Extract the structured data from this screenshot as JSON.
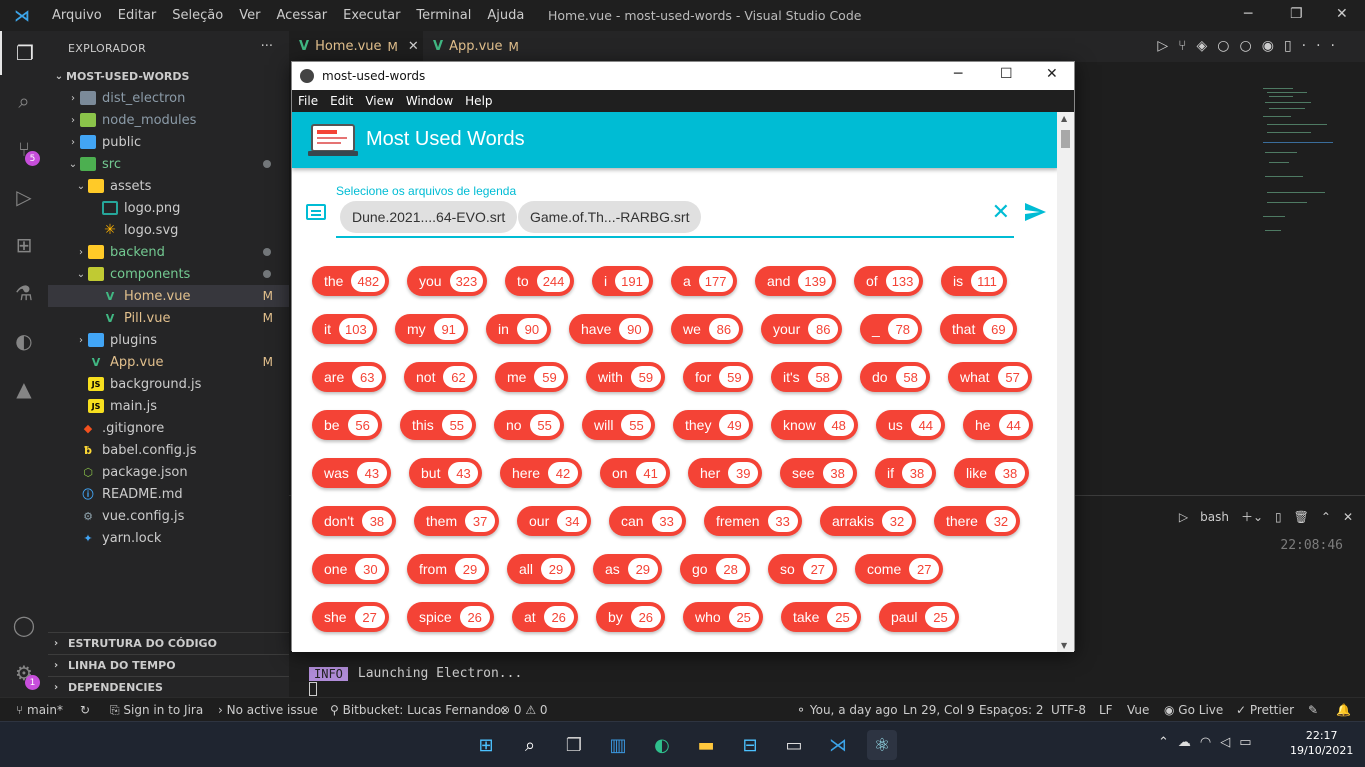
{
  "titlebar": {
    "menu": [
      "Arquivo",
      "Editar",
      "Seleção",
      "Ver",
      "Acessar",
      "Executar",
      "Terminal",
      "Ajuda"
    ],
    "window_title": "Home.vue - most-used-words - Visual Studio Code"
  },
  "activity": {
    "scm_badge": "5",
    "accounts_badge": "1"
  },
  "explorer": {
    "header": "EXPLORADOR",
    "root": "MOST-USED-WORDS",
    "items": [
      {
        "label": "dist_electron",
        "status": ""
      },
      {
        "label": "node_modules",
        "status": ""
      },
      {
        "label": "public",
        "status": ""
      },
      {
        "label": "src",
        "status": ""
      },
      {
        "label": "assets",
        "status": ""
      },
      {
        "label": "logo.png",
        "status": ""
      },
      {
        "label": "logo.svg",
        "status": ""
      },
      {
        "label": "backend",
        "status": ""
      },
      {
        "label": "components",
        "status": ""
      },
      {
        "label": "Home.vue",
        "status": "M"
      },
      {
        "label": "Pill.vue",
        "status": "M"
      },
      {
        "label": "plugins",
        "status": ""
      },
      {
        "label": "App.vue",
        "status": "M"
      },
      {
        "label": "background.js",
        "status": ""
      },
      {
        "label": "main.js",
        "status": ""
      },
      {
        "label": ".gitignore",
        "status": ""
      },
      {
        "label": "babel.config.js",
        "status": ""
      },
      {
        "label": "package.json",
        "status": ""
      },
      {
        "label": "README.md",
        "status": ""
      },
      {
        "label": "vue.config.js",
        "status": ""
      },
      {
        "label": "yarn.lock",
        "status": ""
      }
    ],
    "sections": [
      "ESTRUTURA DO CÓDIGO",
      "LINHA DO TEMPO",
      "DEPENDENCIES"
    ]
  },
  "tabs": [
    {
      "label": "Home.vue",
      "status": "M"
    },
    {
      "label": "App.vue",
      "status": "M"
    }
  ],
  "panel": {
    "shell": "bash",
    "clock": "22:08:46",
    "log_tag": "INFO",
    "log_text": "Launching Electron..."
  },
  "statusbar": {
    "branch": "main*",
    "jira": "Sign in to Jira",
    "issue": "No active issue",
    "bitbucket": "Bitbucket: Lucas Fernando:",
    "problems": "⊗ 0 ⚠ 0",
    "blame": "You, a day ago",
    "position": "Ln 29, Col 9",
    "spaces": "Espaços: 2",
    "encoding": "UTF-8",
    "eol": "LF",
    "language": "Vue",
    "golive": "Go Live",
    "prettier": "Prettier"
  },
  "taskbar": {
    "time": "22:17",
    "date": "19/10/2021"
  },
  "electron": {
    "title": "most-used-words",
    "menu": [
      "File",
      "Edit",
      "View",
      "Window",
      "Help"
    ],
    "app_title": "Most Used Words",
    "field_label": "Selecione os arquivos de legenda",
    "chips": [
      "Dune.2021....64-EVO.srt",
      "Game.of.Th...-RARBG.srt"
    ],
    "words": [
      [
        [
          "the",
          "482"
        ],
        [
          "you",
          "323"
        ],
        [
          "to",
          "244"
        ],
        [
          "i",
          "191"
        ],
        [
          "a",
          "177"
        ],
        [
          "and",
          "139"
        ],
        [
          "of",
          "133"
        ],
        [
          "is",
          "111"
        ]
      ],
      [
        [
          "it",
          "103"
        ],
        [
          "my",
          "91"
        ],
        [
          "in",
          "90"
        ],
        [
          "have",
          "90"
        ],
        [
          "we",
          "86"
        ],
        [
          "your",
          "86"
        ],
        [
          "_",
          "78"
        ],
        [
          "that",
          "69"
        ]
      ],
      [
        [
          "are",
          "63"
        ],
        [
          "not",
          "62"
        ],
        [
          "me",
          "59"
        ],
        [
          "with",
          "59"
        ],
        [
          "for",
          "59"
        ],
        [
          "it's",
          "58"
        ],
        [
          "do",
          "58"
        ],
        [
          "what",
          "57"
        ]
      ],
      [
        [
          "be",
          "56"
        ],
        [
          "this",
          "55"
        ],
        [
          "no",
          "55"
        ],
        [
          "will",
          "55"
        ],
        [
          "they",
          "49"
        ],
        [
          "know",
          "48"
        ],
        [
          "us",
          "44"
        ],
        [
          "he",
          "44"
        ]
      ],
      [
        [
          "was",
          "43"
        ],
        [
          "but",
          "43"
        ],
        [
          "here",
          "42"
        ],
        [
          "on",
          "41"
        ],
        [
          "her",
          "39"
        ],
        [
          "see",
          "38"
        ],
        [
          "if",
          "38"
        ],
        [
          "like",
          "38"
        ]
      ],
      [
        [
          "don't",
          "38"
        ],
        [
          "them",
          "37"
        ],
        [
          "our",
          "34"
        ],
        [
          "can",
          "33"
        ],
        [
          "fremen",
          "33"
        ],
        [
          "arrakis",
          "32"
        ],
        [
          "there",
          "32"
        ]
      ],
      [
        [
          "one",
          "30"
        ],
        [
          "from",
          "29"
        ],
        [
          "all",
          "29"
        ],
        [
          "as",
          "29"
        ],
        [
          "go",
          "28"
        ],
        [
          "so",
          "27"
        ],
        [
          "come",
          "27"
        ]
      ],
      [
        [
          "she",
          "27"
        ],
        [
          "spice",
          "26"
        ],
        [
          "at",
          "26"
        ],
        [
          "by",
          "26"
        ],
        [
          "who",
          "25"
        ],
        [
          "take",
          "25"
        ],
        [
          "paul",
          "25"
        ]
      ]
    ]
  }
}
